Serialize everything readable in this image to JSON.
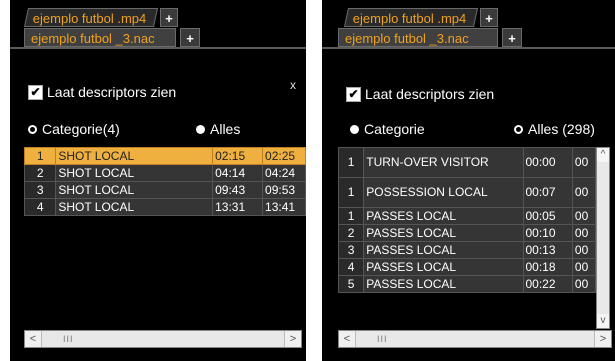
{
  "left": {
    "tabs": {
      "back": "ejemplo futbol .mp4",
      "back_plus": "+",
      "active": "ejemplo futbol _3.nac",
      "active_plus": "+"
    },
    "checkbox": {
      "label": "Laat descriptors zien",
      "mark": "✔"
    },
    "close_label": "x",
    "radio": {
      "categorie": "Categorie(4)",
      "alles": "Alles"
    },
    "rows": [
      {
        "num": "1",
        "name": "SHOT LOCAL",
        "start": "02:15",
        "end": "02:25",
        "selected": true
      },
      {
        "num": "2",
        "name": "SHOT LOCAL",
        "start": "04:14",
        "end": "04:24",
        "selected": false
      },
      {
        "num": "3",
        "name": "SHOT LOCAL",
        "start": "09:43",
        "end": "09:53",
        "selected": false
      },
      {
        "num": "4",
        "name": "SHOT LOCAL",
        "start": "13:31",
        "end": "13:41",
        "selected": false
      }
    ],
    "scrollbar": {
      "left": "<",
      "right": ">",
      "grip": "III"
    }
  },
  "right": {
    "tabs": {
      "back": "ejemplo futbol .mp4",
      "back_plus": "+",
      "active": "ejemplo futbol _3.nac",
      "active_plus": "+"
    },
    "checkbox": {
      "label": "Laat descriptors zien",
      "mark": "✔"
    },
    "radio": {
      "categorie": "Categorie",
      "alles": "Alles (298)"
    },
    "rows": [
      {
        "num": "1",
        "name": "TURN-OVER VISITOR",
        "start": "00:00",
        "end": "00"
      },
      {
        "num": "1",
        "name": "POSSESSION LOCAL",
        "start": "00:07",
        "end": "00"
      },
      {
        "num": "1",
        "name": "PASSES LOCAL",
        "start": "00:05",
        "end": "00"
      },
      {
        "num": "2",
        "name": "PASSES LOCAL",
        "start": "00:10",
        "end": "00"
      },
      {
        "num": "3",
        "name": "PASSES LOCAL",
        "start": "00:13",
        "end": "00"
      },
      {
        "num": "4",
        "name": "PASSES LOCAL",
        "start": "00:18",
        "end": "00"
      },
      {
        "num": "5",
        "name": "PASSES LOCAL",
        "start": "00:22",
        "end": "00"
      }
    ],
    "scrollbar": {
      "left": "<",
      "right": ">",
      "grip": "III"
    },
    "vscroll": {
      "up": "^",
      "down": "v"
    }
  }
}
